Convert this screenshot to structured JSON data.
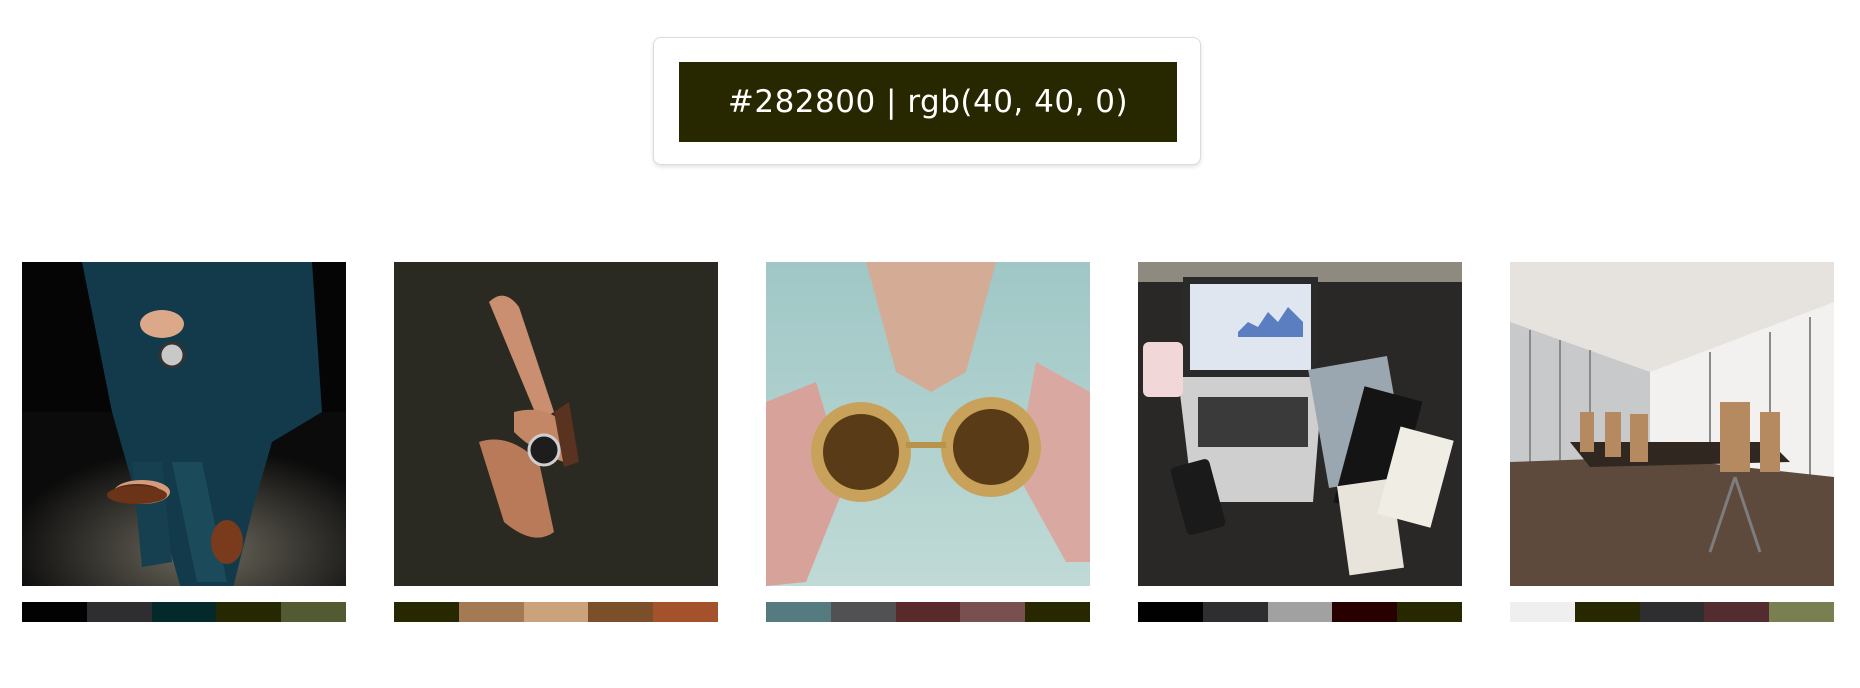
{
  "selected_color": {
    "label": "#282800 | rgb(40, 40, 0)",
    "hex": "#282800"
  },
  "gallery": [
    {
      "subject": "suit-watch-photo",
      "palette": [
        "#020202",
        "#2e2e30",
        "#03292b",
        "#252800",
        "#525a33"
      ]
    },
    {
      "subject": "wrist-watch-photo",
      "palette": [
        "#282800",
        "#a47a55",
        "#caa27c",
        "#7a4f2a",
        "#a4522c"
      ]
    },
    {
      "subject": "sunglasses-photo",
      "palette": [
        "#557b80",
        "#515153",
        "#582a2a",
        "#7a4f50",
        "#282800"
      ]
    },
    {
      "subject": "laptop-desk-photo",
      "palette": [
        "#010101",
        "#2e2e30",
        "#a1a1a1",
        "#280000",
        "#282800"
      ]
    },
    {
      "subject": "conference-room-photo",
      "palette": [
        "#efefef",
        "#282800",
        "#2e2e30",
        "#522c2e",
        "#7a7f52"
      ]
    }
  ]
}
